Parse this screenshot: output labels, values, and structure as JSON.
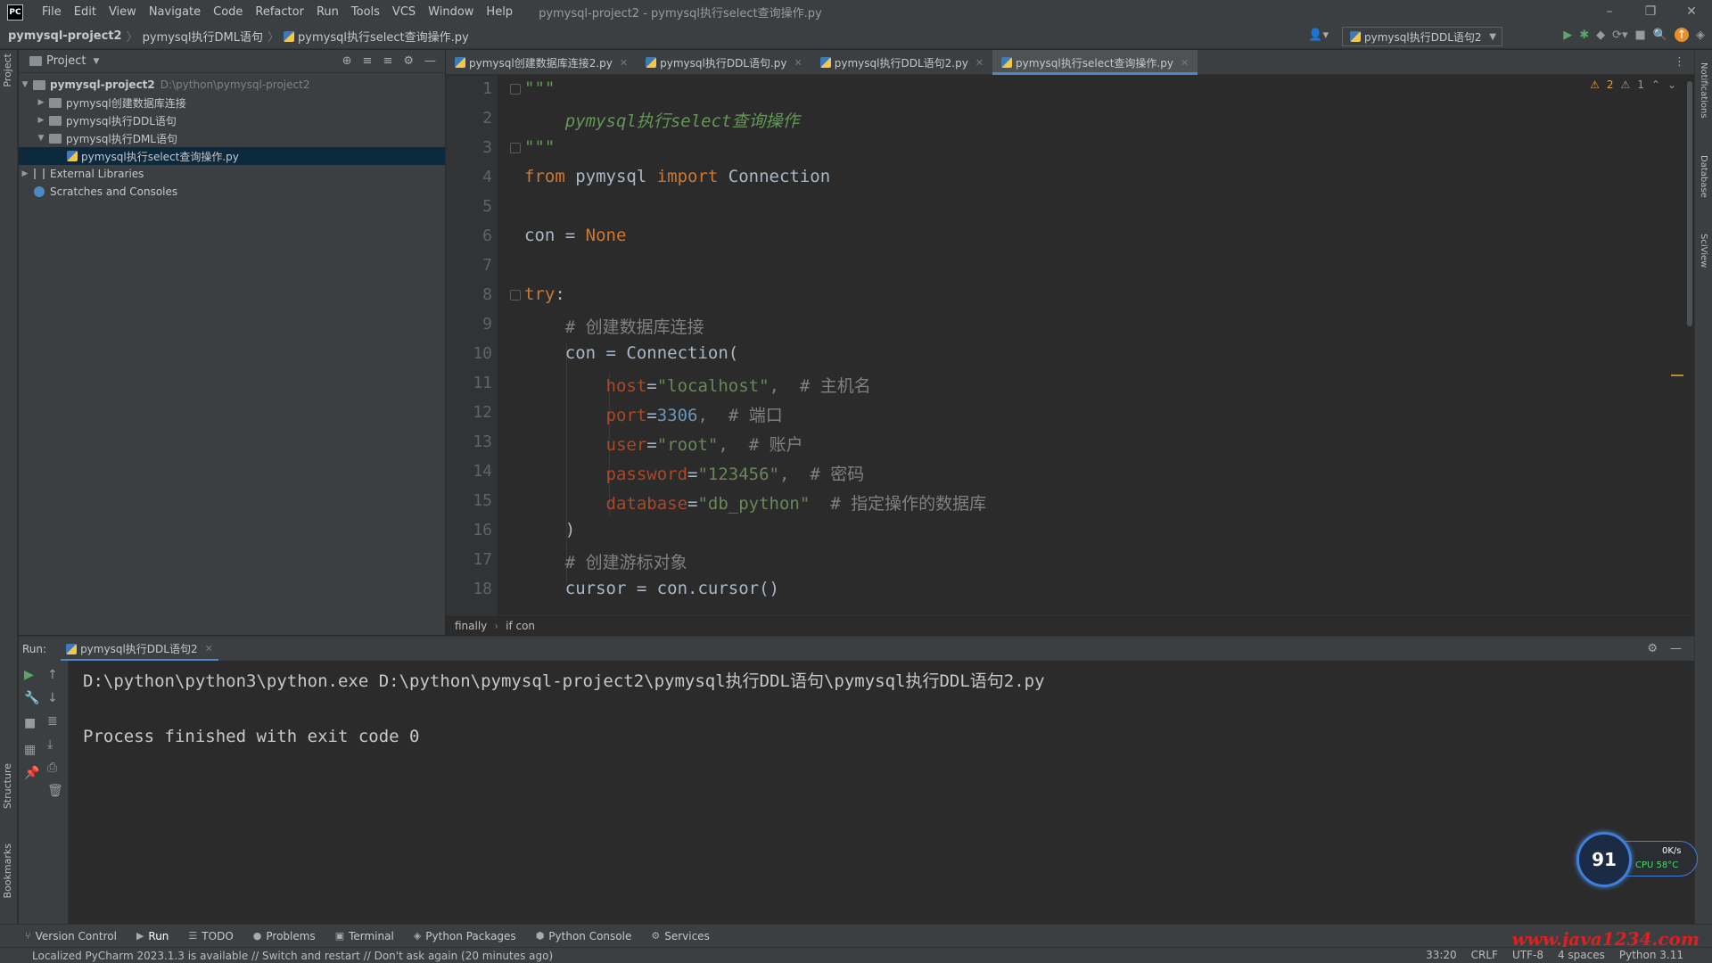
{
  "window": {
    "logo": "PC",
    "title": "pymysql-project2 - pymysql执行select查询操作.py",
    "controls": [
      "–",
      "❐",
      "✕"
    ]
  },
  "menu": [
    "File",
    "Edit",
    "View",
    "Navigate",
    "Code",
    "Refactor",
    "Run",
    "Tools",
    "VCS",
    "Window",
    "Help"
  ],
  "breadcrumbs": [
    "pymysql-project2",
    "pymysql执行DML语句",
    "pymysql执行select查询操作.py"
  ],
  "run_config": "pymysql执行DDL语句2",
  "project_panel": {
    "title": "Project",
    "tree": [
      {
        "label": "pymysql-project2",
        "hint": "D:\\python\\pymysql-project2"
      },
      {
        "label": "pymysql创建数据库连接"
      },
      {
        "label": "pymysql执行DDL语句"
      },
      {
        "label": "pymysql执行DML语句"
      },
      {
        "label": "pymysql执行select查询操作.py"
      },
      {
        "label": "External Libraries"
      },
      {
        "label": "Scratches and Consoles"
      }
    ]
  },
  "editor_tabs": [
    {
      "label": "pymysql创建数据库连接2.py"
    },
    {
      "label": "pymysql执行DDL语句.py"
    },
    {
      "label": "pymysql执行DDL语句2.py"
    },
    {
      "label": "pymysql执行select查询操作.py"
    }
  ],
  "inspections": {
    "warnings": "2",
    "weak_warnings": "1"
  },
  "line_numbers": [
    "1",
    "2",
    "3",
    "4",
    "5",
    "6",
    "7",
    "8",
    "9",
    "10",
    "11",
    "12",
    "13",
    "14",
    "15",
    "16",
    "17",
    "18"
  ],
  "code": {
    "l1": "\"\"\"",
    "l2": "    pymysql执行select查询操作",
    "l3": "\"\"\"",
    "l4_kw1": "from",
    "l4_mod": " pymysql ",
    "l4_kw2": "import",
    "l4_name": " Connection",
    "l6_a": "con = ",
    "l6_kw": "None",
    "l8_kw": "try",
    "l8_b": ":",
    "l9": "    # 创建数据库连接",
    "l10": "    con = Connection(",
    "l11_p": "        host",
    "l11_eq": "=",
    "l11_s": "\"localhost\"",
    "l11_c": ",  # 主机名",
    "l12_p": "        port",
    "l12_eq": "=",
    "l12_n": "3306",
    "l12_c": ",  # 端口",
    "l13_p": "        user",
    "l13_eq": "=",
    "l13_s": "\"root\"",
    "l13_c": ",  # 账户",
    "l14_p": "        password",
    "l14_eq": "=",
    "l14_s": "\"123456\"",
    "l14_c": ",  # 密码",
    "l15_p": "        database",
    "l15_eq": "=",
    "l15_s": "\"db_python\"",
    "l15_c": "  # 指定操作的数据库",
    "l16": "    )",
    "l17": "    # 创建游标对象",
    "l18": "    cursor = con.cursor()"
  },
  "editor_crumbs": [
    "finally",
    "if con"
  ],
  "run_panel": {
    "label": "Run:",
    "tab": "pymysql执行DDL语句2",
    "console": [
      "D:\\python\\python3\\python.exe D:\\python\\pymysql-project2\\pymysql执行DDL语句\\pymysql执行DDL语句2.py",
      "",
      "Process finished with exit code 0"
    ]
  },
  "perf_widget": {
    "score": "91",
    "speed": "0K/s",
    "cpu": "CPU 58°C"
  },
  "bottom_tools": [
    "Version Control",
    "Run",
    "TODO",
    "Problems",
    "Terminal",
    "Python Packages",
    "Python Console",
    "Services"
  ],
  "left_strip": [
    "Project",
    "Structure",
    "Bookmarks"
  ],
  "right_strip": [
    "Notifications",
    "Database",
    "SciView"
  ],
  "status": {
    "message": "Localized PyCharm 2023.1.3 is available // Switch and restart // Don't ask again (20 minutes ago)",
    "position": "33:20",
    "line_sep": "CRLF",
    "encoding": "UTF-8",
    "indent": "4 spaces",
    "interpreter": "Python 3.11"
  },
  "watermark": "www.java1234.com"
}
